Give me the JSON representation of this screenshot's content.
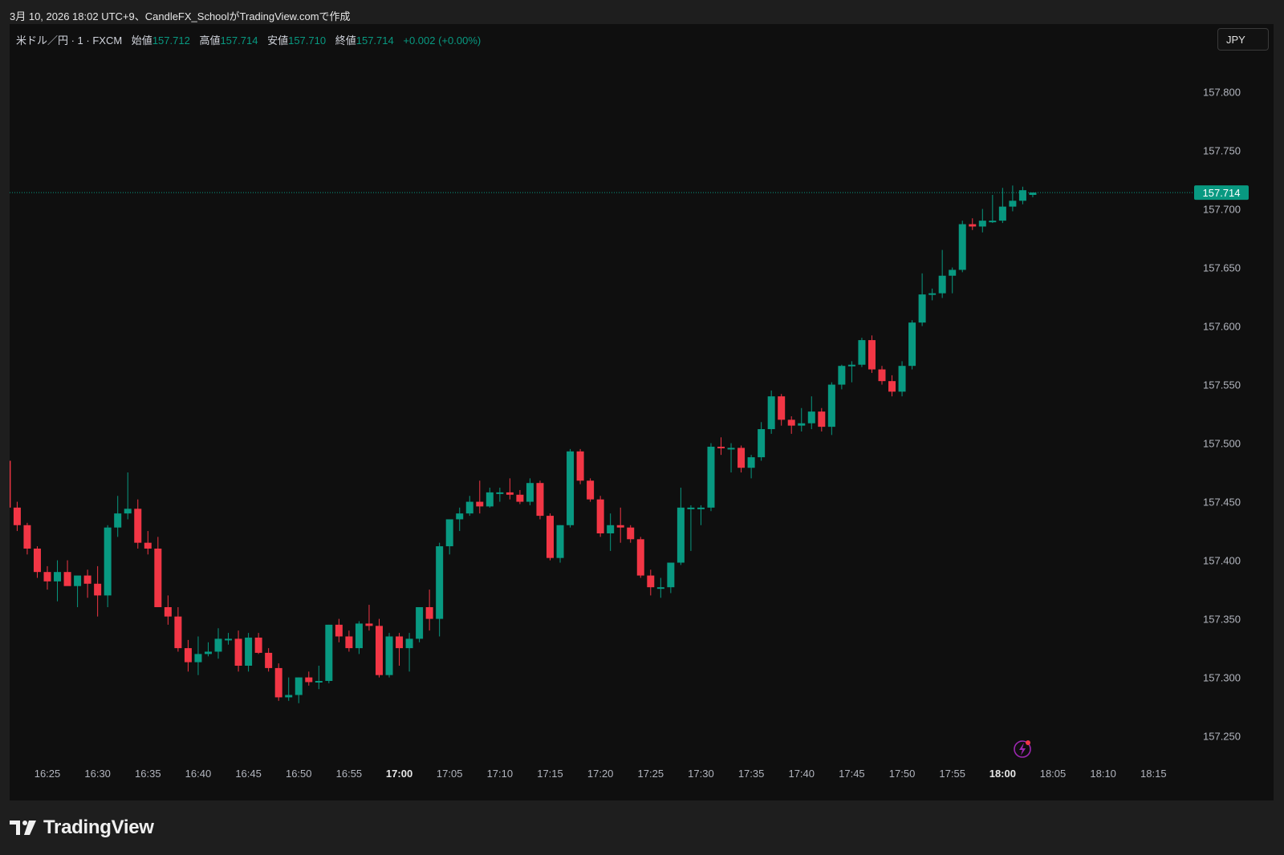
{
  "header": {
    "caption": "3月 10, 2026 18:02 UTC+9、CandleFX_SchoolがTradingView.comで作成"
  },
  "legend": {
    "symbol": "米ドル／円 · 1 · FXCM",
    "open_label": "始値",
    "open_value": "157.712",
    "high_label": "高値",
    "high_value": "157.714",
    "low_label": "安値",
    "low_value": "157.710",
    "close_label": "終値",
    "close_value": "157.714",
    "change": "+0.002 (+0.00%)"
  },
  "currency_button": "JPY",
  "footer": {
    "logo_text": "TradingView"
  },
  "colors": {
    "up": "#089981",
    "down": "#f23645",
    "background": "#0f0f0f",
    "axis_text": "#b2b5be"
  },
  "chart_data": {
    "type": "candlestick",
    "timeframe": "1 minute",
    "y_range": [
      157.22,
      157.83
    ],
    "y_ticks": [
      "157.800",
      "157.750",
      "157.700",
      "157.650",
      "157.600",
      "157.550",
      "157.500",
      "157.450",
      "157.400",
      "157.350",
      "157.300",
      "157.250"
    ],
    "x_ticks": [
      "16:25",
      "16:30",
      "16:35",
      "16:40",
      "16:45",
      "16:50",
      "16:55",
      "17:00",
      "17:05",
      "17:10",
      "17:15",
      "17:20",
      "17:25",
      "17:30",
      "17:35",
      "17:40",
      "17:45",
      "17:50",
      "17:55",
      "18:00",
      "18:05",
      "18:10",
      "18:15"
    ],
    "bold_x_ticks": [
      "17:00",
      "18:00"
    ],
    "last_price": "157.714",
    "first_candle_time": "16:21",
    "candles": [
      [
        157.485,
        157.49,
        157.44,
        157.445
      ],
      [
        157.445,
        157.45,
        157.425,
        157.43
      ],
      [
        157.43,
        157.432,
        157.405,
        157.41
      ],
      [
        157.41,
        157.412,
        157.385,
        157.39
      ],
      [
        157.39,
        157.395,
        157.375,
        157.382
      ],
      [
        157.382,
        157.4,
        157.365,
        157.39
      ],
      [
        157.39,
        157.4,
        157.38,
        157.378
      ],
      [
        157.378,
        157.385,
        157.36,
        157.387
      ],
      [
        157.387,
        157.392,
        157.368,
        157.38
      ],
      [
        157.38,
        157.395,
        157.352,
        157.37
      ],
      [
        157.37,
        157.43,
        157.36,
        157.428
      ],
      [
        157.428,
        157.455,
        157.42,
        157.44
      ],
      [
        157.44,
        157.475,
        157.435,
        157.444
      ],
      [
        157.444,
        157.452,
        157.41,
        157.415
      ],
      [
        157.415,
        157.425,
        157.405,
        157.41
      ],
      [
        157.41,
        157.42,
        157.36,
        157.36
      ],
      [
        157.36,
        157.37,
        157.345,
        157.352
      ],
      [
        157.352,
        157.36,
        157.322,
        157.325
      ],
      [
        157.325,
        157.332,
        157.305,
        157.313
      ],
      [
        157.313,
        157.335,
        157.302,
        157.32
      ],
      [
        157.32,
        157.33,
        157.318,
        157.322
      ],
      [
        157.322,
        157.342,
        157.316,
        157.333
      ],
      [
        157.333,
        157.338,
        157.328,
        157.333
      ],
      [
        157.333,
        157.34,
        157.305,
        157.31
      ],
      [
        157.31,
        157.338,
        157.305,
        157.334
      ],
      [
        157.334,
        157.338,
        157.32,
        157.321
      ],
      [
        157.321,
        157.325,
        157.305,
        157.308
      ],
      [
        157.308,
        157.312,
        157.28,
        157.283
      ],
      [
        157.283,
        157.3,
        157.28,
        157.285
      ],
      [
        157.285,
        157.3,
        157.278,
        157.3
      ],
      [
        157.3,
        157.305,
        157.293,
        157.296
      ],
      [
        157.296,
        157.31,
        157.29,
        157.297
      ],
      [
        157.297,
        157.345,
        157.295,
        157.345
      ],
      [
        157.345,
        157.35,
        157.33,
        157.335
      ],
      [
        157.335,
        157.34,
        157.322,
        157.325
      ],
      [
        157.325,
        157.348,
        157.32,
        157.346
      ],
      [
        157.346,
        157.362,
        157.34,
        157.344
      ],
      [
        157.344,
        157.35,
        157.3,
        157.302
      ],
      [
        157.302,
        157.338,
        157.3,
        157.335
      ],
      [
        157.335,
        157.338,
        157.31,
        157.325
      ],
      [
        157.325,
        157.338,
        157.305,
        157.333
      ],
      [
        157.333,
        157.36,
        157.33,
        157.36
      ],
      [
        157.36,
        157.375,
        157.34,
        157.35
      ],
      [
        157.35,
        157.415,
        157.335,
        157.412
      ],
      [
        157.412,
        157.435,
        157.405,
        157.435
      ],
      [
        157.435,
        157.445,
        157.425,
        157.44
      ],
      [
        157.44,
        157.455,
        157.438,
        157.45
      ],
      [
        157.45,
        157.468,
        157.44,
        157.446
      ],
      [
        157.446,
        157.462,
        157.445,
        157.458
      ],
      [
        157.458,
        157.462,
        157.45,
        157.458
      ],
      [
        157.458,
        157.47,
        157.452,
        157.456
      ],
      [
        157.456,
        157.46,
        157.448,
        157.45
      ],
      [
        157.45,
        157.47,
        157.447,
        157.466
      ],
      [
        157.466,
        157.468,
        157.435,
        157.438
      ],
      [
        157.438,
        157.44,
        157.4,
        157.402
      ],
      [
        157.402,
        157.43,
        157.398,
        157.43
      ],
      [
        157.43,
        157.495,
        157.428,
        157.493
      ],
      [
        157.493,
        157.495,
        157.465,
        157.468
      ],
      [
        157.468,
        157.47,
        157.45,
        157.452
      ],
      [
        157.452,
        157.455,
        157.42,
        157.423
      ],
      [
        157.423,
        157.44,
        157.408,
        157.43
      ],
      [
        157.43,
        157.445,
        157.415,
        157.428
      ],
      [
        157.428,
        157.43,
        157.415,
        157.418
      ],
      [
        157.418,
        157.42,
        157.385,
        157.387
      ],
      [
        157.387,
        157.392,
        157.37,
        157.377
      ],
      [
        157.377,
        157.385,
        157.368,
        157.377
      ],
      [
        157.377,
        157.398,
        157.372,
        157.398
      ],
      [
        157.398,
        157.462,
        157.396,
        157.445
      ],
      [
        157.445,
        157.447,
        157.408,
        157.445
      ],
      [
        157.445,
        157.447,
        157.43,
        157.445
      ],
      [
        157.445,
        157.5,
        157.442,
        157.497
      ],
      [
        157.497,
        157.505,
        157.49,
        157.496
      ],
      [
        157.496,
        157.5,
        157.475,
        157.496
      ],
      [
        157.496,
        157.498,
        157.475,
        157.479
      ],
      [
        157.479,
        157.49,
        157.47,
        157.488
      ],
      [
        157.488,
        157.518,
        157.485,
        157.512
      ],
      [
        157.512,
        157.545,
        157.508,
        157.54
      ],
      [
        157.54,
        157.542,
        157.515,
        157.52
      ],
      [
        157.52,
        157.523,
        157.508,
        157.515
      ],
      [
        157.515,
        157.53,
        157.51,
        157.517
      ],
      [
        157.517,
        157.54,
        157.512,
        157.527
      ],
      [
        157.527,
        157.53,
        157.51,
        157.514
      ],
      [
        157.514,
        157.552,
        157.507,
        157.55
      ],
      [
        157.55,
        157.567,
        157.546,
        157.566
      ],
      [
        157.566,
        157.57,
        157.552,
        157.567
      ],
      [
        157.567,
        157.59,
        157.565,
        157.588
      ],
      [
        157.588,
        157.592,
        157.56,
        157.563
      ],
      [
        157.563,
        157.566,
        157.55,
        157.553
      ],
      [
        157.553,
        157.558,
        157.54,
        157.544
      ],
      [
        157.544,
        157.57,
        157.54,
        157.566
      ],
      [
        157.566,
        157.605,
        157.563,
        157.603
      ],
      [
        157.603,
        157.645,
        157.6,
        157.627
      ],
      [
        157.627,
        157.632,
        157.622,
        157.628
      ],
      [
        157.628,
        157.665,
        157.624,
        157.643
      ],
      [
        157.643,
        157.65,
        157.628,
        157.648
      ],
      [
        157.648,
        157.69,
        157.646,
        157.687
      ],
      [
        157.687,
        157.692,
        157.682,
        157.685
      ],
      [
        157.685,
        157.7,
        157.68,
        157.69
      ],
      [
        157.69,
        157.712,
        157.688,
        157.69
      ],
      [
        157.69,
        157.718,
        157.688,
        157.702
      ],
      [
        157.702,
        157.72,
        157.698,
        157.707
      ],
      [
        157.707,
        157.719,
        157.704,
        157.716
      ],
      [
        157.712,
        157.714,
        157.71,
        157.714
      ]
    ]
  }
}
